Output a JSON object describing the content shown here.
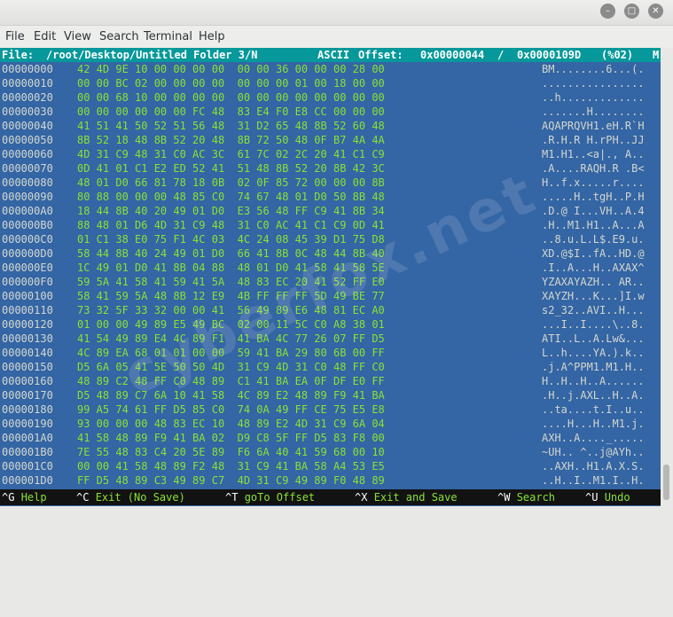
{
  "window": {
    "minimize_icon": "minimize-icon",
    "maximize_icon": "maximize-icon",
    "close_icon": "close-icon"
  },
  "menu": [
    "File",
    "Edit",
    "View",
    "Search",
    "Terminal",
    "Help"
  ],
  "status": {
    "file_label": "File:",
    "path": "/root/Desktop/Untitled Folder 3/N",
    "mode": "ASCII",
    "offset_label": "Offset:",
    "offset": "0x00000044",
    "separator": "/",
    "size": "0x0000109D",
    "percent": "(%02)",
    "flag": "M"
  },
  "rows": [
    {
      "addr": "00000000",
      "hex": "42 4D 9E 10 00 00 00 00  00 00 36 00 00 00 28 00",
      "ascii": "BM........6...(."
    },
    {
      "addr": "00000010",
      "hex": "00 00 BC 02 00 00 00 00  00 00 00 01 00 18 00 00",
      "ascii": "................"
    },
    {
      "addr": "00000020",
      "hex": "00 00 68 10 00 00 00 00  00 00 00 00 00 00 00 00",
      "ascii": "..h............."
    },
    {
      "addr": "00000030",
      "hex": "00 00 00 00 00 00 FC 48  83 E4 F0 E8 CC 00 00 00",
      "ascii": ".......H........"
    },
    {
      "addr": "00000040",
      "hex": "41 51 41 50 52 51 56 48  31 D2 65 48 8B 52 60 48",
      "ascii": "AQAPRQVH1.eH.R`H"
    },
    {
      "addr": "00000050",
      "hex": "8B 52 18 48 8B 52 20 48  8B 72 50 48 0F B7 4A 4A",
      "ascii": ".R.H.R H.rPH..JJ"
    },
    {
      "addr": "00000060",
      "hex": "4D 31 C9 48 31 C0 AC 3C  61 7C 02 2C 20 41 C1 C9",
      "ascii": "M1.H1..<a|., A.."
    },
    {
      "addr": "00000070",
      "hex": "0D 41 01 C1 E2 ED 52 41  51 48 8B 52 20 8B 42 3C",
      "ascii": ".A....RAQH.R .B<"
    },
    {
      "addr": "00000080",
      "hex": "48 01 D0 66 81 78 18 0B  02 0F 85 72 00 00 00 8B",
      "ascii": "H..f.x.....r...."
    },
    {
      "addr": "00000090",
      "hex": "80 88 00 00 00 48 85 C0  74 67 48 01 D0 50 8B 48",
      "ascii": ".....H..tgH..P.H"
    },
    {
      "addr": "000000A0",
      "hex": "18 44 8B 40 20 49 01 D0  E3 56 48 FF C9 41 8B 34",
      "ascii": ".D.@ I...VH..A.4"
    },
    {
      "addr": "000000B0",
      "hex": "88 48 01 D6 4D 31 C9 48  31 C0 AC 41 C1 C9 0D 41",
      "ascii": ".H..M1.H1..A...A"
    },
    {
      "addr": "000000C0",
      "hex": "01 C1 38 E0 75 F1 4C 03  4C 24 08 45 39 D1 75 D8",
      "ascii": "..8.u.L.L$.E9.u."
    },
    {
      "addr": "000000D0",
      "hex": "58 44 8B 40 24 49 01 D0  66 41 8B 0C 48 44 8B 40",
      "ascii": "XD.@$I..fA..HD.@"
    },
    {
      "addr": "000000E0",
      "hex": "1C 49 01 D0 41 8B 04 88  48 01 D0 41 58 41 58 5E",
      "ascii": ".I..A...H..AXAX^"
    },
    {
      "addr": "000000F0",
      "hex": "59 5A 41 58 41 59 41 5A  48 83 EC 20 41 52 FF E0",
      "ascii": "YZAXAYAZH.. AR.."
    },
    {
      "addr": "00000100",
      "hex": "58 41 59 5A 48 8B 12 E9  4B FF FF FF 5D 49 BE 77",
      "ascii": "XAYZH...K...]I.w"
    },
    {
      "addr": "00000110",
      "hex": "73 32 5F 33 32 00 00 41  56 49 89 E6 48 81 EC A0",
      "ascii": "s2_32..AVI..H..."
    },
    {
      "addr": "00000120",
      "hex": "01 00 00 49 89 E5 49 BC  02 00 11 5C C0 A8 38 01",
      "ascii": "...I..I....\\..8."
    },
    {
      "addr": "00000130",
      "hex": "41 54 49 89 E4 4C 89 F1  41 BA 4C 77 26 07 FF D5",
      "ascii": "ATI..L..A.Lw&..."
    },
    {
      "addr": "00000140",
      "hex": "4C 89 EA 68 01 01 00 00  59 41 BA 29 80 6B 00 FF",
      "ascii": "L..h....YA.).k.."
    },
    {
      "addr": "00000150",
      "hex": "D5 6A 05 41 5E 50 50 4D  31 C9 4D 31 C0 48 FF C0",
      "ascii": ".j.A^PPM1.M1.H.."
    },
    {
      "addr": "00000160",
      "hex": "48 89 C2 48 FF C0 48 89  C1 41 BA EA 0F DF E0 FF",
      "ascii": "H..H..H..A......"
    },
    {
      "addr": "00000170",
      "hex": "D5 48 89 C7 6A 10 41 58  4C 89 E2 48 89 F9 41 BA",
      "ascii": ".H..j.AXL..H..A."
    },
    {
      "addr": "00000180",
      "hex": "99 A5 74 61 FF D5 85 C0  74 0A 49 FF CE 75 E5 E8",
      "ascii": "..ta....t.I..u.."
    },
    {
      "addr": "00000190",
      "hex": "93 00 00 00 48 83 EC 10  48 89 E2 4D 31 C9 6A 04",
      "ascii": "....H...H..M1.j."
    },
    {
      "addr": "000001A0",
      "hex": "41 58 48 89 F9 41 BA 02  D9 C8 5F FF D5 83 F8 00",
      "ascii": "AXH..A...._....."
    },
    {
      "addr": "000001B0",
      "hex": "7E 55 48 83 C4 20 5E 89  F6 6A 40 41 59 68 00 10",
      "ascii": "~UH.. ^..j@AYh.."
    },
    {
      "addr": "000001C0",
      "hex": "00 00 41 58 48 89 F2 48  31 C9 41 BA 58 A4 53 E5",
      "ascii": "..AXH..H1.A.X.S."
    },
    {
      "addr": "000001D0",
      "hex": "FF D5 48 89 C3 49 89 C7  4D 31 C9 49 89 F0 48 89",
      "ascii": "..H..I..M1.I..H."
    }
  ],
  "shortcuts": [
    {
      "key": "^G",
      "label": "Help"
    },
    {
      "key": "^C",
      "label": "Exit (No Save)"
    },
    {
      "key": "^T",
      "label": "goTo Offset"
    },
    {
      "key": "^X",
      "label": "Exit and Save"
    },
    {
      "key": "^W",
      "label": "Search"
    },
    {
      "key": "^U",
      "label": "Undo"
    }
  ],
  "watermark": "cyberfox.net"
}
